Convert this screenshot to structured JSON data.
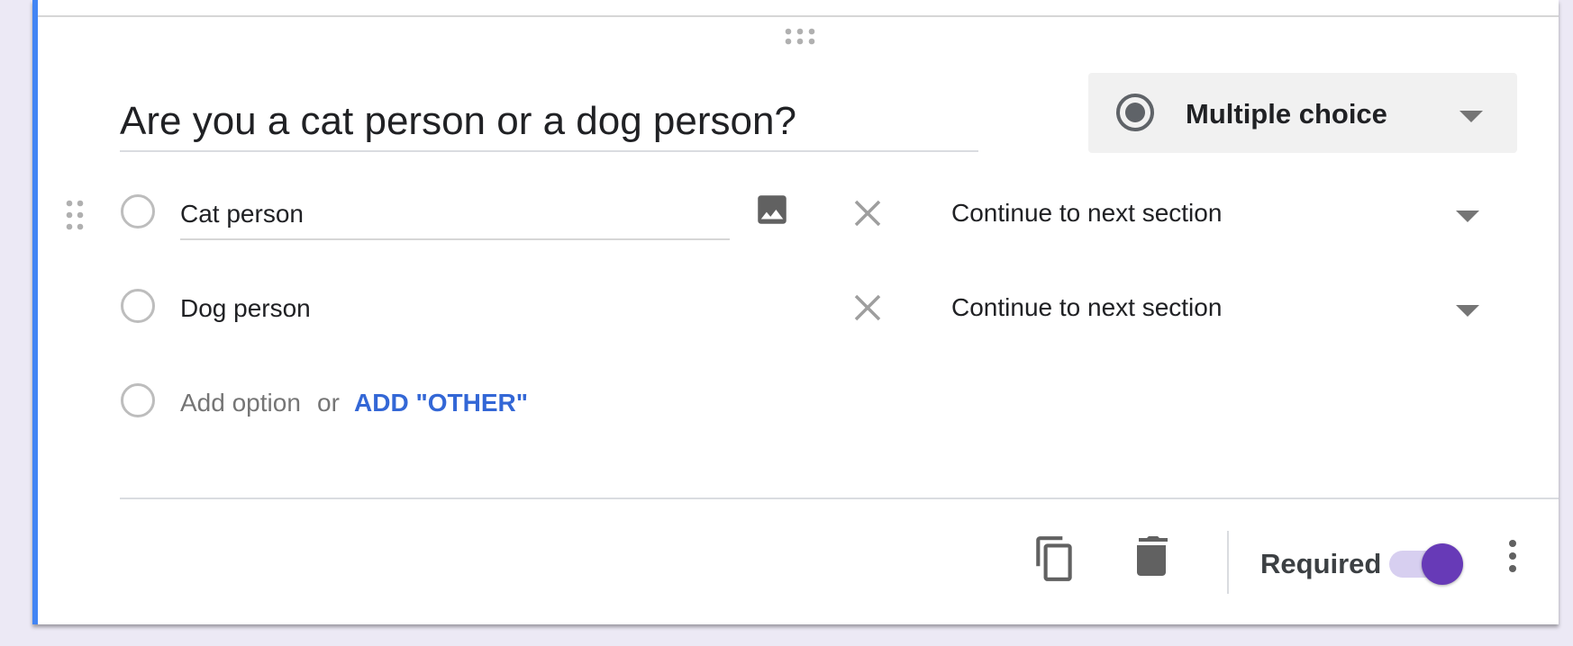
{
  "question": {
    "title": "Are you a cat person or a dog person?",
    "type_label": "Multiple choice",
    "type_icon": "radio-checked-icon"
  },
  "options": [
    {
      "label": "Cat person",
      "goto": "Continue to next section"
    },
    {
      "label": "Dog person",
      "goto": "Continue to next section"
    }
  ],
  "add_option": {
    "placeholder": "Add option",
    "or": "or",
    "add_other": "ADD \"OTHER\""
  },
  "footer": {
    "required_label": "Required",
    "required_on": true
  },
  "colors": {
    "accent_left": "#4285f4",
    "toggle": "#673ab7",
    "link": "#3367d6"
  }
}
